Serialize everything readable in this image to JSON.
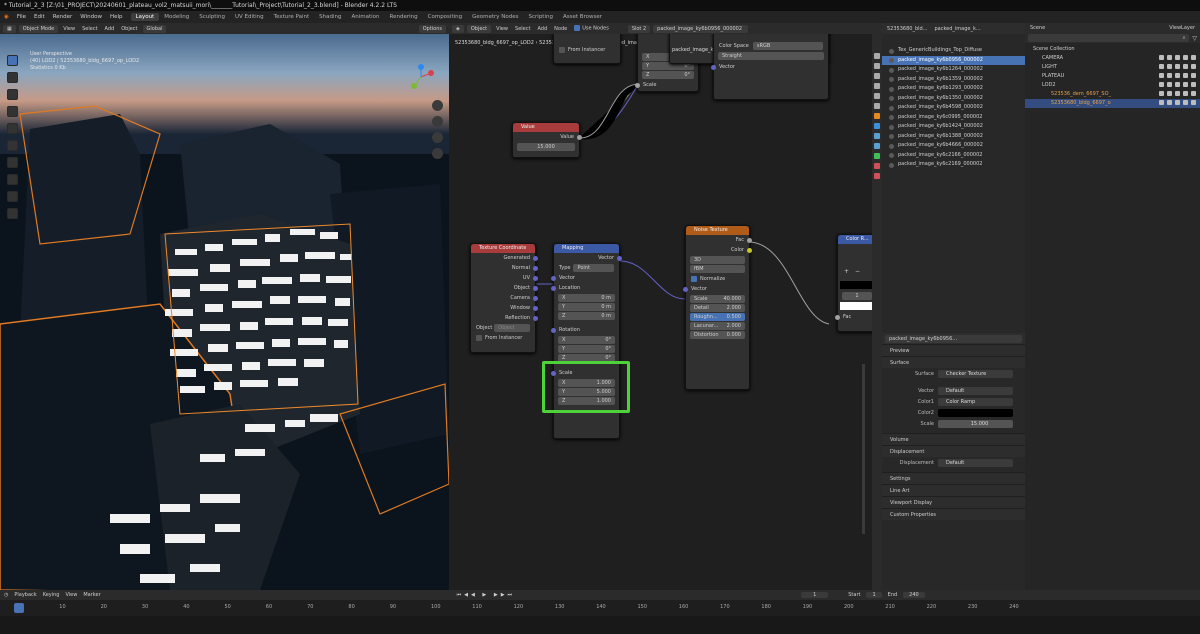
{
  "window": {
    "title": "* Tutorial_2_3 [Z:\\01_PROJECT\\20240601_plateau_vol2_matsuii_mori\\_______Tutorial\\_Project\\Tutorial_2_3.blend] - Blender 4.2.2 LTS"
  },
  "menu": [
    "File",
    "Edit",
    "Render",
    "Window",
    "Help"
  ],
  "workspaces": [
    "Layout",
    "Modeling",
    "Sculpting",
    "UV Editing",
    "Texture Paint",
    "Shading",
    "Animation",
    "Rendering",
    "Compositing",
    "Geometry Nodes",
    "Scripting",
    "Asset Browser"
  ],
  "active_workspace": "Layout",
  "viewport": {
    "mode": "Object Mode",
    "menus": [
      "View",
      "Select",
      "Add",
      "Object"
    ],
    "transform": "Global",
    "options": "Options",
    "overlay_lines": [
      "User Perspective",
      "(40) LOD2 | 52353680_bldg_6697_op_LOD2",
      "Statistics 0 Kb"
    ]
  },
  "node_editor": {
    "header": {
      "mode": "Object",
      "menus": [
        "View",
        "Select",
        "Add",
        "Node"
      ],
      "use_nodes": "Use Nodes",
      "slot": "Slot 2",
      "image": "packed_image_ky6b0956_000002"
    },
    "breadcrumb": [
      "52353680_bldg_6697_op_LOD2",
      "52353680_bldg_6697_op",
      "packed_image_ky6b0956_000002"
    ],
    "top_node": {
      "from_instancer": "From Instancer"
    },
    "vector_node": {
      "x": "X",
      "x_val": "0°",
      "y": "Y",
      "y_val": "0°",
      "z": "Z",
      "z_val": "0°",
      "scale": "Scale"
    },
    "color_space_node": {
      "color_space_label": "Color Space",
      "color_space": "sRGB",
      "alpha": "Straight",
      "vector": "Vector"
    },
    "value_node": {
      "title": "Value",
      "output": "Value",
      "value": "15.000"
    },
    "texcoord": {
      "title": "Texture Coordinate",
      "outputs": [
        "Generated",
        "Normal",
        "UV",
        "Object",
        "Camera",
        "Window",
        "Reflection"
      ],
      "object_label": "Object",
      "object_placeholder": "Object",
      "from_instancer": "From Instancer"
    },
    "mapping": {
      "title": "Mapping",
      "output": "Vector",
      "type_label": "Type",
      "type": "Point",
      "vector": "Vector",
      "location": "Location",
      "loc": [
        [
          "X",
          "0 m"
        ],
        [
          "Y",
          "0 m"
        ],
        [
          "Z",
          "0 m"
        ]
      ],
      "rotation": "Rotation",
      "rot": [
        [
          "X",
          "0°"
        ],
        [
          "Y",
          "0°"
        ],
        [
          "Z",
          "0°"
        ]
      ],
      "scale": "Scale",
      "sc": [
        [
          "X",
          "1.000"
        ],
        [
          "Y",
          "5.000"
        ],
        [
          "Z",
          "1.000"
        ]
      ]
    },
    "noise": {
      "title": "Noise Texture",
      "outputs": [
        "Fac",
        "Color"
      ],
      "dim": "3D",
      "noise_type": "fBM",
      "normalize": "Normalize",
      "vector": "Vector",
      "fields": [
        [
          "Scale",
          "40.000"
        ],
        [
          "Detail",
          "2.000"
        ],
        [
          "Roughn...",
          "0.500"
        ],
        [
          "Lacunar...",
          "2.000"
        ],
        [
          "Distortion",
          "0.000"
        ]
      ]
    },
    "color_ramp": {
      "title": "Color R...",
      "plus": "+",
      "minus": "−",
      "index": "1",
      "fac": "Fac"
    }
  },
  "image_list": {
    "header": "52353680_bld...",
    "header2": "packed_image_k...",
    "items": [
      "Tex_GenericBuildings_Top_Diffuse",
      "packed_image_ky6b0956_000002",
      "packed_image_ky6b1264_000002",
      "packed_image_ky6b1359_000002",
      "packed_image_ky6b1293_000002",
      "packed_image_ky6b1350_000002",
      "packed_image_ky6b4598_000002",
      "packed_image_ky6c0995_000002",
      "packed_image_ky6b1424_000002",
      "packed_image_ky6b1388_000002",
      "packed_image_ky6b4666_000002",
      "packed_image_ky6c2166_000002",
      "packed_image_ky6c2169_000002"
    ],
    "selected": 1
  },
  "properties": {
    "material": "packed_image_ky6b0956...",
    "preview": "Preview",
    "surface_section": "Surface",
    "rows": [
      [
        "Surface",
        "Checker Texture"
      ],
      [
        "Vector",
        "Default"
      ],
      [
        "Color1",
        "Color Ramp"
      ],
      [
        "Color2",
        ""
      ],
      [
        "Scale",
        "15.000"
      ]
    ],
    "sections": [
      "Volume",
      "Displacement"
    ],
    "displacement_row": [
      "Displacement",
      "Default"
    ],
    "sections2": [
      "Settings",
      "Line Art",
      "Viewport Display",
      "Custom Properties"
    ]
  },
  "outliner": {
    "scene": "Scene",
    "view_layer": "ViewLayer",
    "search_placeholder": "",
    "items": [
      {
        "label": "Scene Collection",
        "indent": 0
      },
      {
        "label": "CAMERA",
        "indent": 1
      },
      {
        "label": "LIGHT",
        "indent": 1
      },
      {
        "label": "PLATEAU",
        "indent": 1
      },
      {
        "label": "LOD2",
        "indent": 1
      },
      {
        "label": "523536_dem_6697_SO_",
        "indent": 2
      },
      {
        "label": "52353680_bldg_6697_o",
        "indent": 2
      }
    ],
    "selected": 6
  },
  "timeline": {
    "menus": [
      "Playback",
      "Keying",
      "View",
      "Marker"
    ],
    "current_frame": "1",
    "start_label": "Start",
    "start": "1",
    "end_label": "End",
    "end": "240",
    "ticks": [
      "0",
      "10",
      "20",
      "30",
      "40",
      "50",
      "60",
      "70",
      "80",
      "90",
      "100",
      "110",
      "120",
      "130",
      "140",
      "150",
      "160",
      "170",
      "180",
      "190",
      "200",
      "210",
      "220",
      "230",
      "240"
    ]
  },
  "colors": {
    "accent": "#4772b3",
    "highlight": "#4fd13a",
    "vector_socket": "#6363c7",
    "texture_header": "#b05c18",
    "converter_header": "#3c59a6",
    "input_header": "#a83c3c"
  }
}
